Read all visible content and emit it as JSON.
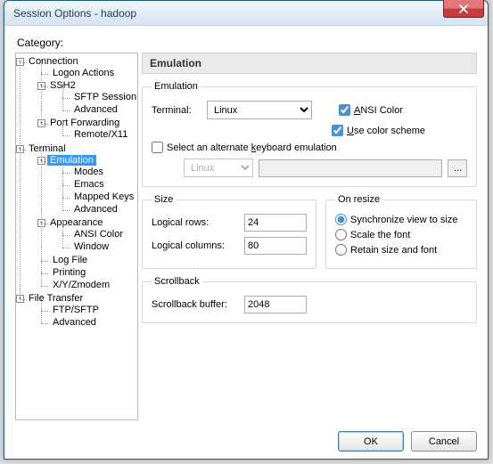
{
  "window": {
    "title": "Session Options - hadoop"
  },
  "category_label": "Category:",
  "tree": {
    "connection": "Connection",
    "logon_actions": "Logon Actions",
    "ssh2": "SSH2",
    "sftp_session": "SFTP Session",
    "advanced_ssh2": "Advanced",
    "port_forwarding": "Port Forwarding",
    "remote_x11": "Remote/X11",
    "terminal": "Terminal",
    "emulation": "Emulation",
    "modes": "Modes",
    "emacs": "Emacs",
    "mapped_keys": "Mapped Keys",
    "advanced_emu": "Advanced",
    "appearance": "Appearance",
    "ansi_color": "ANSI Color",
    "window": "Window",
    "log_file": "Log File",
    "printing": "Printing",
    "xyzmodem": "X/Y/Zmodem",
    "file_transfer": "File Transfer",
    "ftp_sftp": "FTP/SFTP",
    "advanced_ft": "Advanced"
  },
  "panel": {
    "header": "Emulation",
    "emulation": {
      "legend": "Emulation",
      "terminal_label": "Terminal:",
      "terminal_value": "Linux",
      "ansi_color": "ANSI Color",
      "ansi_color_checked": true,
      "use_color_scheme": "Use color scheme",
      "use_color_scheme_checked": true,
      "alt_kb": "Select an alternate keyboard emulation",
      "alt_kb_checked": false,
      "alt_kb_value": "Linux",
      "alt_kb_path": "",
      "dots": "..."
    },
    "size": {
      "legend": "Size",
      "rows_label": "Logical rows:",
      "rows_value": "24",
      "cols_label": "Logical columns:",
      "cols_value": "80"
    },
    "on_resize": {
      "legend": "On resize",
      "sync": "Synchronize view to size",
      "scale": "Scale the font",
      "retain": "Retain size and font",
      "selected": "sync"
    },
    "scrollback": {
      "legend": "Scrollback",
      "buffer_label": "Scrollback buffer:",
      "buffer_value": "2048"
    }
  },
  "footer": {
    "ok": "OK",
    "cancel": "Cancel"
  }
}
